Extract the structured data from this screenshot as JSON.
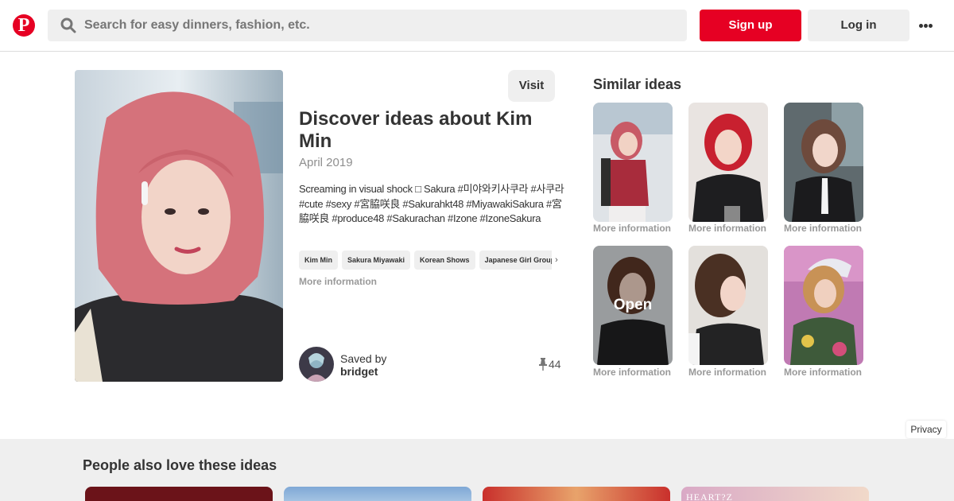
{
  "header": {
    "logo_letter": "P",
    "search_placeholder": "Search for easy dinners, fashion, etc.",
    "signup_label": "Sign up",
    "login_label": "Log in",
    "accent_color": "#e60023"
  },
  "pin": {
    "visit_label": "Visit",
    "title": "Discover ideas about Kim Min",
    "date": "April 2019",
    "description": "Screaming in visual shock □ Sakura #미야와키사쿠라 #사쿠라 #cute #sexy #宮脇咲良 #Sakurahkt48 #MiyawakiSakura #宮脇咲良 #produce48 #Sakurachan #Izone #IzoneSakura",
    "tags": [
      "Kim Min",
      "Sakura Miyawaki",
      "Korean Shows",
      "Japanese Girl Group"
    ],
    "more_info": "More information",
    "saved_by_label": "Saved by",
    "saved_by_user": "bridget",
    "save_count": "44"
  },
  "similar": {
    "heading": "Similar ideas",
    "more_info": "More information",
    "open_label": "Open"
  },
  "privacy_label": "Privacy",
  "bottom": {
    "heading": "People also love these ideas",
    "card_text": "HEART?Z"
  }
}
